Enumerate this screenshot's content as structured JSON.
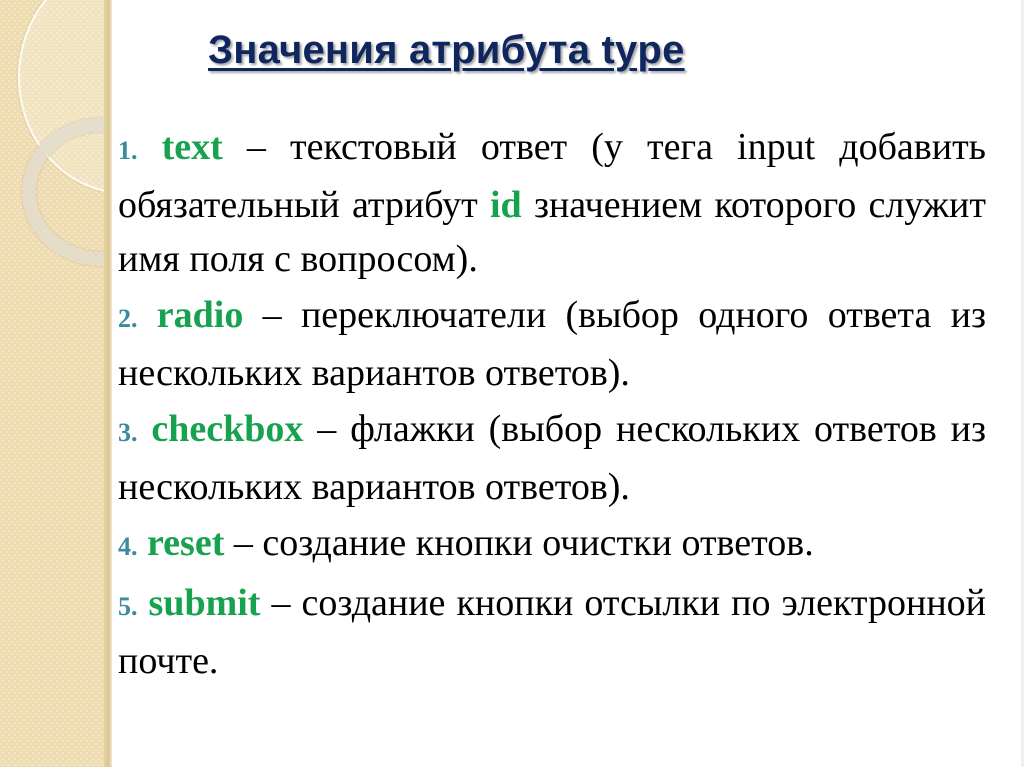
{
  "slide": {
    "title": "Значения атрибута type",
    "accent_colors": {
      "title": "#10265f",
      "number": "#3a8aa0",
      "keyword": "#17a24f"
    },
    "items": [
      {
        "number": "1.",
        "keyword": "text",
        "text_before": " – текстовый ответ (у тега input добавить обязательный атрибут ",
        "inline_keyword": "id",
        "text_after": " значением которого служит имя поля с вопросом)."
      },
      {
        "number": "2.",
        "keyword": "radio",
        "text_before": " – переключатели (выбор одного ответа  из нескольких вариантов ответов)."
      },
      {
        "number": "3.",
        "keyword": "checkbox",
        "text_before": " – флажки (выбор нескольких ответов  из нескольких вариантов ответов)."
      },
      {
        "number": "4.",
        "keyword": "reset",
        "text_before": " – создание кнопки очистки ответов."
      },
      {
        "number": "5.",
        "keyword": "submit",
        "text_before": " – создание кнопки отсылки по электронной почте."
      }
    ]
  }
}
